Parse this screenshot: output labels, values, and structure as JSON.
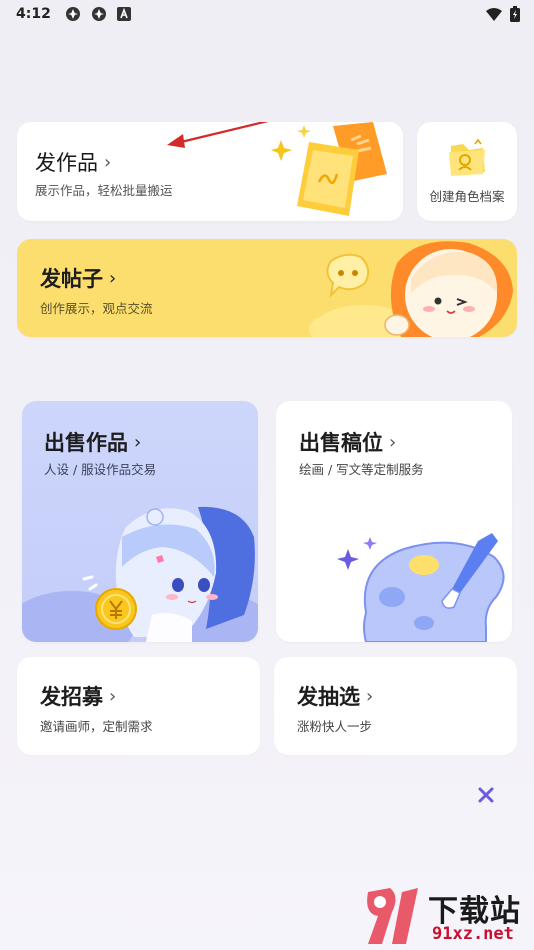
{
  "status_bar": {
    "time": "4:12",
    "icons": [
      "app-icon-1",
      "app-icon-2",
      "app-a-icon",
      "wifi-icon",
      "battery-icon"
    ]
  },
  "post_work": {
    "title": "发作品",
    "subtitle": "展示作品，轻松批量搬运"
  },
  "create_role": {
    "label": "创建角色档案"
  },
  "post_thread": {
    "title": "发帖子",
    "subtitle": "创作展示，观点交流"
  },
  "sell_work": {
    "title": "出售作品",
    "subtitle": "人设 / 服设作品交易"
  },
  "sell_slot": {
    "title": "出售稿位",
    "subtitle": "绘画 / 写文等定制服务"
  },
  "recruit": {
    "title": "发招募",
    "subtitle": "邀请画师，定制需求"
  },
  "lottery": {
    "title": "发抽选",
    "subtitle": "涨粉快人一步"
  },
  "watermark": {
    "name": "下载站",
    "domain": "91xz.net",
    "badge": "91"
  },
  "colors": {
    "accent_yellow": "#fbde6e",
    "sell_blue": "#c9d2fa",
    "close_purple": "#6a5be0",
    "annotation_red": "#d42a2a"
  }
}
